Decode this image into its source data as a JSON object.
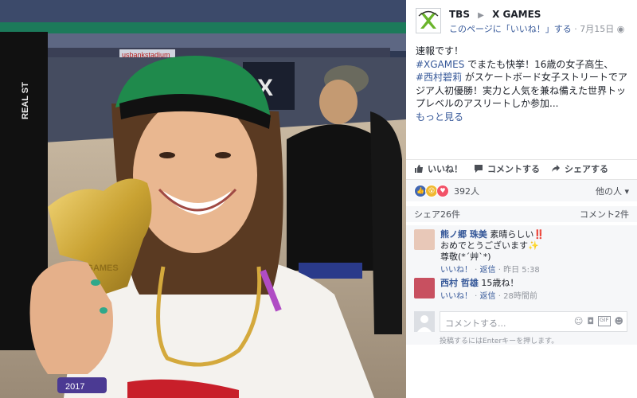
{
  "photo": {
    "stadium_banner": "usbankstadium",
    "medal_text": "X GAMES",
    "event_sign": "REAL ST",
    "wristband_text": "2017"
  },
  "post": {
    "page_name": "TBS",
    "shared_to": "X GAMES",
    "like_page_link": "このページに「いいね！」する",
    "date": "7月15日",
    "text_line1": "速報です！",
    "hashtag1": "#XGAMES",
    "text_line2": " でまたも快挙！16歳の女子高生、",
    "hashtag2": "#西村碧莉",
    "text_line3": " がスケートボード女子ストリートでアジア人初優勝！実力と人気を兼ね備えた世界トップレベルのアスリートしか参加...",
    "see_more": "もっと見る"
  },
  "actions": {
    "like": "いいね！",
    "comment": "コメントする",
    "share": "シェアする"
  },
  "reactions": {
    "count": "392人",
    "sort": "他の人",
    "shares": "シェア26件",
    "comments_count": "コメント2件"
  },
  "comments": [
    {
      "name": "熊ノ郷 珠美",
      "text1": "素晴らしい‼️",
      "text2": "おめでとうございます✨",
      "text3": "尊敬(*´艸`*)",
      "like": "いいね！",
      "reply": "返信",
      "time": "昨日 5:38"
    },
    {
      "name": "西村 哲雄",
      "text1": "15歳ね！",
      "like": "いいね！",
      "reply": "返信",
      "time": "28時間前"
    }
  ],
  "compose": {
    "placeholder": "コメントする...",
    "hint": "投稿するにはEnterキーを押します。"
  },
  "colors": {
    "link": "#365899",
    "brand_green": "#6ab42b",
    "like_blue": "#4267b2"
  }
}
